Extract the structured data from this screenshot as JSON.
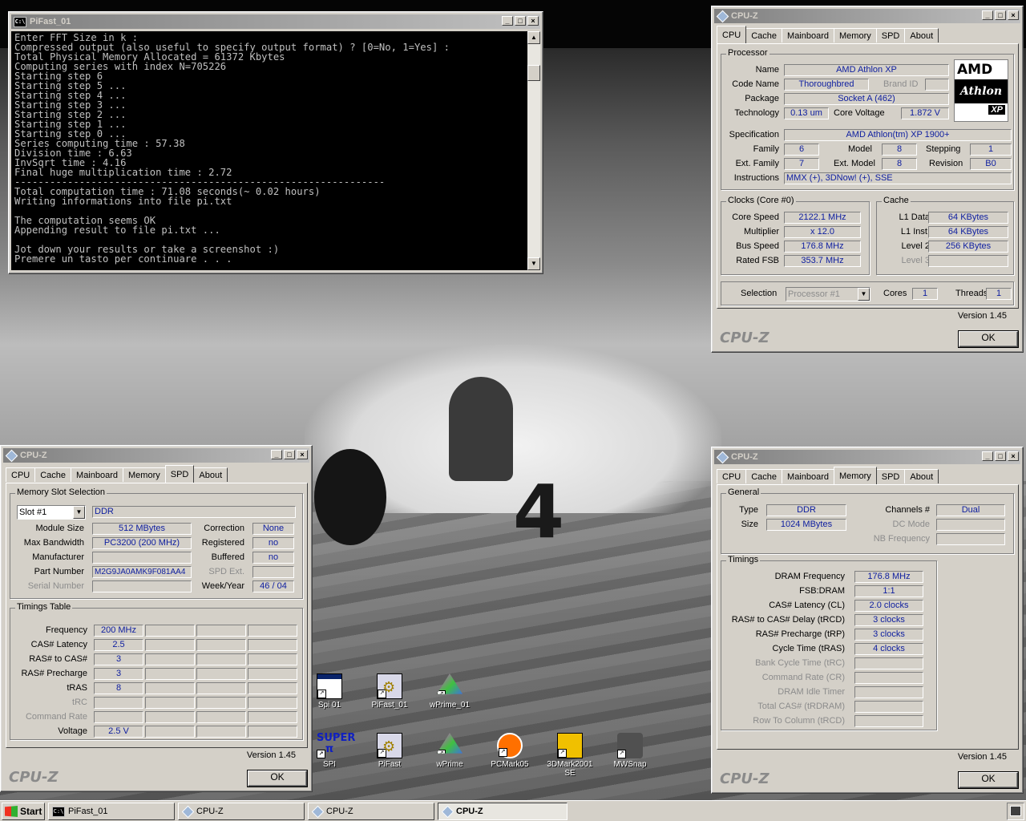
{
  "console": {
    "title": "PiFast_01",
    "lines": [
      "Enter FFT Size in k :",
      "Compressed output (also useful to specify output format) ? [0=No, 1=Yes] :",
      "Total Physical Memory Allocated = 61372 Kbytes",
      "Computing series with index N=705226",
      "Starting step 6",
      "Starting step 5 ...",
      "Starting step 4 ...",
      "Starting step 3 ...",
      "Starting step 2 ...",
      "Starting step 1 ...",
      "Starting step 0 ...",
      "Series computing time : 57.38",
      "Division time : 6.63",
      "InvSqrt time : 4.16",
      "Final huge multiplication time : 2.72",
      "---------------------------------------------------------------",
      "Total computation time : 71.08 seconds(~ 0.02 hours)",
      "Writing informations into file pi.txt",
      "",
      "The computation seems OK",
      "Appending result to file pi.txt ...",
      "",
      "Jot down your results or take a screenshot :)",
      "Premere un tasto per continuare . . ."
    ]
  },
  "tabs": [
    "CPU",
    "Cache",
    "Mainboard",
    "Memory",
    "SPD",
    "About"
  ],
  "cpu_window": {
    "title": "CPU-Z",
    "selected_tab": "CPU",
    "processor": {
      "group": "Processor",
      "name_label": "Name",
      "name": "AMD Athlon XP",
      "codename_label": "Code Name",
      "codename": "Thoroughbred",
      "brand_id_label": "Brand ID",
      "brand_id": "",
      "package_label": "Package",
      "package": "Socket A (462)",
      "technology_label": "Technology",
      "technology": "0.13 um",
      "core_voltage_label": "Core Voltage",
      "core_voltage": "1.872 V",
      "spec_label": "Specification",
      "spec": "AMD Athlon(tm) XP 1900+",
      "family_label": "Family",
      "family": "6",
      "model_label": "Model",
      "model": "8",
      "stepping_label": "Stepping",
      "stepping": "1",
      "ext_family_label": "Ext. Family",
      "ext_family": "7",
      "ext_model_label": "Ext. Model",
      "ext_model": "8",
      "revision_label": "Revision",
      "revision": "B0",
      "instructions_label": "Instructions",
      "instructions": "MMX (+), 3DNow! (+), SSE",
      "logo": {
        "brand": "AMD",
        "line": "Athlon",
        "suffix": "XP"
      }
    },
    "clocks": {
      "group": "Clocks (Core #0)",
      "core_speed_label": "Core Speed",
      "core_speed": "2122.1 MHz",
      "multiplier_label": "Multiplier",
      "multiplier": "x 12.0",
      "bus_speed_label": "Bus Speed",
      "bus_speed": "176.8 MHz",
      "rated_fsb_label": "Rated FSB",
      "rated_fsb": "353.7 MHz"
    },
    "cache": {
      "group": "Cache",
      "l1d_label": "L1 Data",
      "l1d": "64 KBytes",
      "l1i_label": "L1 Inst.",
      "l1i": "64 KBytes",
      "l2_label": "Level 2",
      "l2": "256 KBytes",
      "l3_label": "Level 3",
      "l3": ""
    },
    "selection_label": "Selection",
    "selection": "Processor #1",
    "cores_label": "Cores",
    "cores": "1",
    "threads_label": "Threads",
    "threads": "1",
    "version": "Version 1.45",
    "brand": "CPU-Z",
    "ok": "OK"
  },
  "spd_window": {
    "title": "CPU-Z",
    "selected_tab": "SPD",
    "slot_group": "Memory Slot Selection",
    "slot": "Slot #1",
    "type": "DDR",
    "module_size_label": "Module Size",
    "module_size": "512 MBytes",
    "max_bw_label": "Max Bandwidth",
    "max_bw": "PC3200 (200 MHz)",
    "manufacturer_label": "Manufacturer",
    "manufacturer": "",
    "part_label": "Part Number",
    "part": "M2G9JA0AMK9F081AA4",
    "serial_label": "Serial Number",
    "serial": "",
    "correction_label": "Correction",
    "correction": "None",
    "registered_label": "Registered",
    "registered": "no",
    "buffered_label": "Buffered",
    "buffered": "no",
    "spd_ext_label": "SPD Ext.",
    "spd_ext": "",
    "week_year_label": "Week/Year",
    "week_year": "46 / 04",
    "timings_group": "Timings Table",
    "timings": [
      {
        "label": "Frequency",
        "value": "200 MHz",
        "dim": false
      },
      {
        "label": "CAS# Latency",
        "value": "2.5",
        "dim": false
      },
      {
        "label": "RAS# to CAS#",
        "value": "3",
        "dim": false
      },
      {
        "label": "RAS# Precharge",
        "value": "3",
        "dim": false
      },
      {
        "label": "tRAS",
        "value": "8",
        "dim": false
      },
      {
        "label": "tRC",
        "value": "",
        "dim": true
      },
      {
        "label": "Command Rate",
        "value": "",
        "dim": true
      },
      {
        "label": "Voltage",
        "value": "2.5 V",
        "dim": false
      }
    ],
    "version": "Version 1.45",
    "brand": "CPU-Z",
    "ok": "OK"
  },
  "mem_window": {
    "title": "CPU-Z",
    "selected_tab": "Memory",
    "general_group": "General",
    "type_label": "Type",
    "type": "DDR",
    "size_label": "Size",
    "size": "1024 MBytes",
    "channels_label": "Channels #",
    "channels": "Dual",
    "dc_mode_label": "DC Mode",
    "dc_mode": "",
    "nb_freq_label": "NB Frequency",
    "nb_freq": "",
    "timings_group": "Timings",
    "timings": [
      {
        "label": "DRAM Frequency",
        "value": "176.8 MHz",
        "dim": false
      },
      {
        "label": "FSB:DRAM",
        "value": "1:1",
        "dim": false
      },
      {
        "label": "CAS# Latency (CL)",
        "value": "2.0 clocks",
        "dim": false
      },
      {
        "label": "RAS# to CAS# Delay (tRCD)",
        "value": "3 clocks",
        "dim": false
      },
      {
        "label": "RAS# Precharge (tRP)",
        "value": "3 clocks",
        "dim": false
      },
      {
        "label": "Cycle Time (tRAS)",
        "value": "4 clocks",
        "dim": false
      },
      {
        "label": "Bank Cycle Time (tRC)",
        "value": "",
        "dim": true
      },
      {
        "label": "Command Rate (CR)",
        "value": "",
        "dim": true
      },
      {
        "label": "DRAM Idle Timer",
        "value": "",
        "dim": true
      },
      {
        "label": "Total CAS# (tRDRAM)",
        "value": "",
        "dim": true
      },
      {
        "label": "Row To Column (tRCD)",
        "value": "",
        "dim": true
      }
    ],
    "version": "Version 1.45",
    "brand": "CPU-Z",
    "ok": "OK"
  },
  "desktop": {
    "wallpaper_number": "4",
    "icons_row1": [
      {
        "name": "spi-01-icon",
        "label": "Spi 01",
        "kind": "prog"
      },
      {
        "name": "pifast-01-icon",
        "label": "PiFast_01",
        "kind": "gear"
      },
      {
        "name": "wprime-01-icon",
        "label": "wPrime_01",
        "kind": "pyr"
      }
    ],
    "icons_row2": [
      {
        "name": "superpi-icon",
        "label": "SPI",
        "kind": "super"
      },
      {
        "name": "pifast-icon",
        "label": "PiFast",
        "kind": "gear"
      },
      {
        "name": "wprime-icon",
        "label": "wPrime",
        "kind": "pyr"
      },
      {
        "name": "pcmark05-icon",
        "label": "PCMark05",
        "kind": "pcm"
      },
      {
        "name": "3dmark2001se-icon",
        "label": "3DMark2001 SE",
        "kind": "tdm"
      },
      {
        "name": "mwsnap-icon",
        "label": "MWSnap",
        "kind": "cam"
      }
    ]
  },
  "taskbar": {
    "start": "Start",
    "tasks": [
      "PiFast_01",
      "CPU-Z",
      "CPU-Z",
      "CPU-Z"
    ]
  }
}
